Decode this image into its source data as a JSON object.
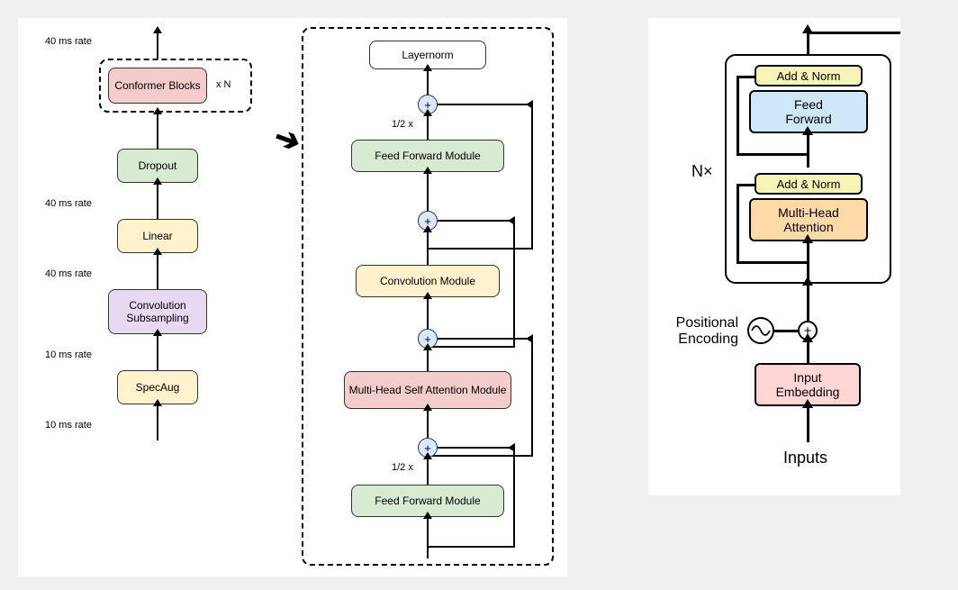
{
  "left": {
    "rate40_top": "40 ms rate",
    "conformer_blocks": "Conformer Blocks",
    "x_n": "x N",
    "dropout": "Dropout",
    "rate40_mid": "40 ms rate",
    "linear": "Linear",
    "rate40_low": "40 ms rate",
    "conv_sub": "Convolution Subsampling",
    "rate10_a": "10 ms rate",
    "specaug": "SpecAug",
    "rate10_b": "10 ms rate"
  },
  "detail": {
    "layernorm": "Layernorm",
    "half_top": "1/2 x",
    "ff_top": "Feed Forward Module",
    "conv": "Convolution Module",
    "mhsa": "Multi-Head Self Attention Module",
    "half_bot": "1/2 x",
    "ff_bot": "Feed Forward Module",
    "plus": "+"
  },
  "right": {
    "nx": "N×",
    "addnorm1": "Add & Norm",
    "feedforward": "Feed\nForward",
    "addnorm2": "Add & Norm",
    "mha": "Multi-Head\nAttention",
    "positional": "Positional\nEncoding",
    "input_emb": "Input\nEmbedding",
    "inputs": "Inputs"
  }
}
